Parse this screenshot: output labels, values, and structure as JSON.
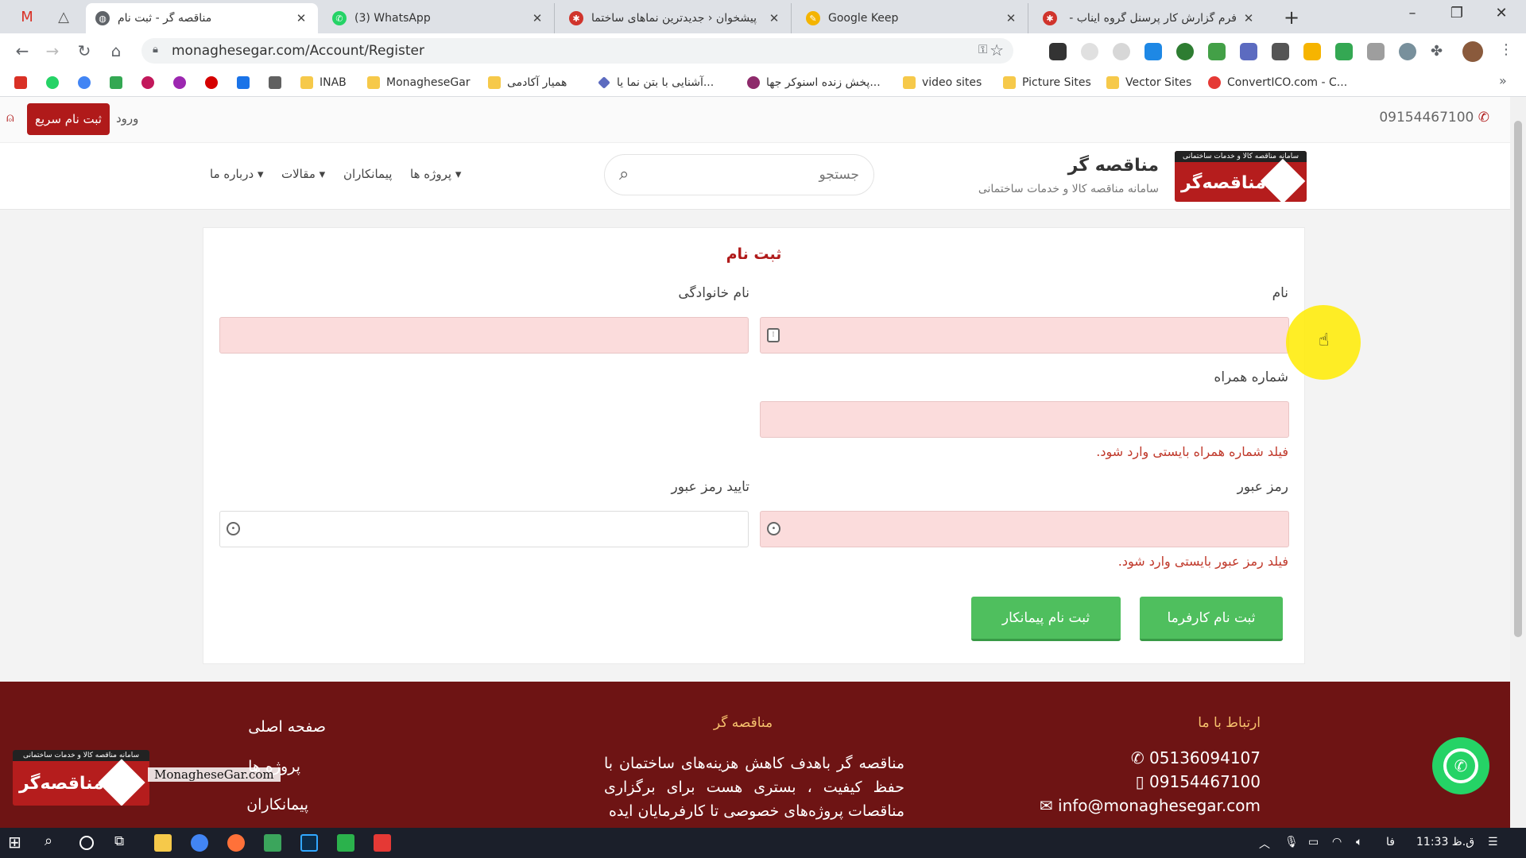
{
  "tabs": [
    {
      "title": "مناقصه گر - ثبت نام",
      "favicon_color": "#5f6368",
      "active": true
    },
    {
      "title": "(3) WhatsApp",
      "favicon_color": "#25d366",
      "active": false
    },
    {
      "title": "پیشخوان ‹ جدیدترین نماهای ساختما",
      "favicon_color": "#d0342c",
      "active": false
    },
    {
      "title": "Google Keep",
      "favicon_color": "#f4b400",
      "active": false
    },
    {
      "title": "فرم گزارش کار پرسنل گروه ایناب - ...",
      "favicon_color": "#d0342c",
      "active": false
    }
  ],
  "pinned_tabs": [
    "gmail-icon",
    "drive-icon"
  ],
  "window_controls": {
    "minimize": "–",
    "restore": "❐",
    "close": "✕"
  },
  "address_bar": {
    "url": "monaghesegar.com/Account/Register"
  },
  "bookmarks": [
    {
      "label": "",
      "icon": "gmail-icon",
      "color": "#d93025"
    },
    {
      "label": "",
      "icon": "whatsapp-icon",
      "color": "#25d366"
    },
    {
      "label": "",
      "icon": "google-icon",
      "color": "#4285f4"
    },
    {
      "label": "",
      "icon": "analytics-icon",
      "color": "#34a853"
    },
    {
      "label": "",
      "icon": "tool-icon",
      "color": "#c2185b"
    },
    {
      "label": "",
      "icon": "tool-icon",
      "color": "#9c27b0"
    },
    {
      "label": "",
      "icon": "opera-icon",
      "color": "#d50000"
    },
    {
      "label": "",
      "icon": "maps-icon",
      "color": "#1a73e8"
    },
    {
      "label": "",
      "icon": "drive-icon",
      "color": "#616161"
    },
    {
      "label": "INAB",
      "icon": "folder-icon",
      "color": "#f6c94a"
    },
    {
      "label": "MonagheseGar",
      "icon": "folder-icon",
      "color": "#f6c94a"
    },
    {
      "label": "همیار آکادمی",
      "icon": "folder-icon",
      "color": "#f6c94a"
    },
    {
      "label": "آشنایی با بتن نما یا...",
      "icon": "diamond-icon",
      "color": "#5c6bc0"
    },
    {
      "label": "پخش زنده اسنوکر جها...",
      "icon": "snooker-icon",
      "color": "#8e2a6b"
    },
    {
      "label": "video sites",
      "icon": "folder-icon",
      "color": "#f6c94a"
    },
    {
      "label": "Picture Sites",
      "icon": "folder-icon",
      "color": "#f6c94a"
    },
    {
      "label": "Vector Sites",
      "icon": "folder-icon",
      "color": "#f6c94a"
    },
    {
      "label": "ConvertICO.com - C...",
      "icon": "convertico-icon",
      "color": "#e53935"
    }
  ],
  "util_bar": {
    "quick_register": "ثبت نام سریع",
    "login": "ورود",
    "phone": "09154467100"
  },
  "header": {
    "brand_title": "مناقصه گر",
    "brand_subtitle": "سامانه مناقصه کالا و خدمات ساختمانی",
    "logo_text": "مناقصه‌گر",
    "logo_banner": "سامانه مناقصه کالا و خدمات ساختمانی",
    "search_placeholder": "جستجو",
    "nav": [
      {
        "label": "پروژه ها",
        "dropdown": true
      },
      {
        "label": "پیمانکاران",
        "dropdown": false
      },
      {
        "label": "مقالات",
        "dropdown": true
      },
      {
        "label": "درباره ما",
        "dropdown": true
      }
    ]
  },
  "form": {
    "title": "ثبت نام",
    "first_name_label": "نام",
    "last_name_label": "نام خانوادگی",
    "mobile_label": "شماره همراه",
    "mobile_error": "فیلد شماره همراه بایستی وارد شود.",
    "password_label": "رمز عبور",
    "password_error": "فیلد رمز عبور بایستی وارد شود.",
    "confirm_password_label": "تایید رمز عبور",
    "employer_button": "ثبت نام کارفرما",
    "contractor_button": "ثبت نام پیمانکار"
  },
  "footer": {
    "contact_heading": "ارتباط با ما",
    "phone_landline": "05136094107",
    "phone_mobile": "09154467100",
    "email": "info@monaghesegar.com",
    "about_heading": "مناقصه گر",
    "about_text": "مناقصه گر باهدف کاهش هزینه‌های ساختمان با حفظ کیفیت ، بستری هست برای برگزاری مناقصات پروژه‌های خصوصی تا کارفرمایان ایده",
    "links": [
      "صفحه اصلی",
      "پروژه ها",
      "پیمانکاران"
    ],
    "logo_text": "مناقصه‌گر",
    "logo_banner": "سامانه مناقصه کالا و خدمات ساختمانی",
    "watermark": "MonagheseGar.com"
  },
  "taskbar": {
    "time": "11:33 ق.ظ",
    "lang": "فا"
  },
  "colors": {
    "brand_red": "#b01a1a",
    "footer_bg": "#6e1414",
    "button_green": "#4fbf5e",
    "error_red": "#c0392b",
    "invalid_field": "#fbdcdc"
  }
}
